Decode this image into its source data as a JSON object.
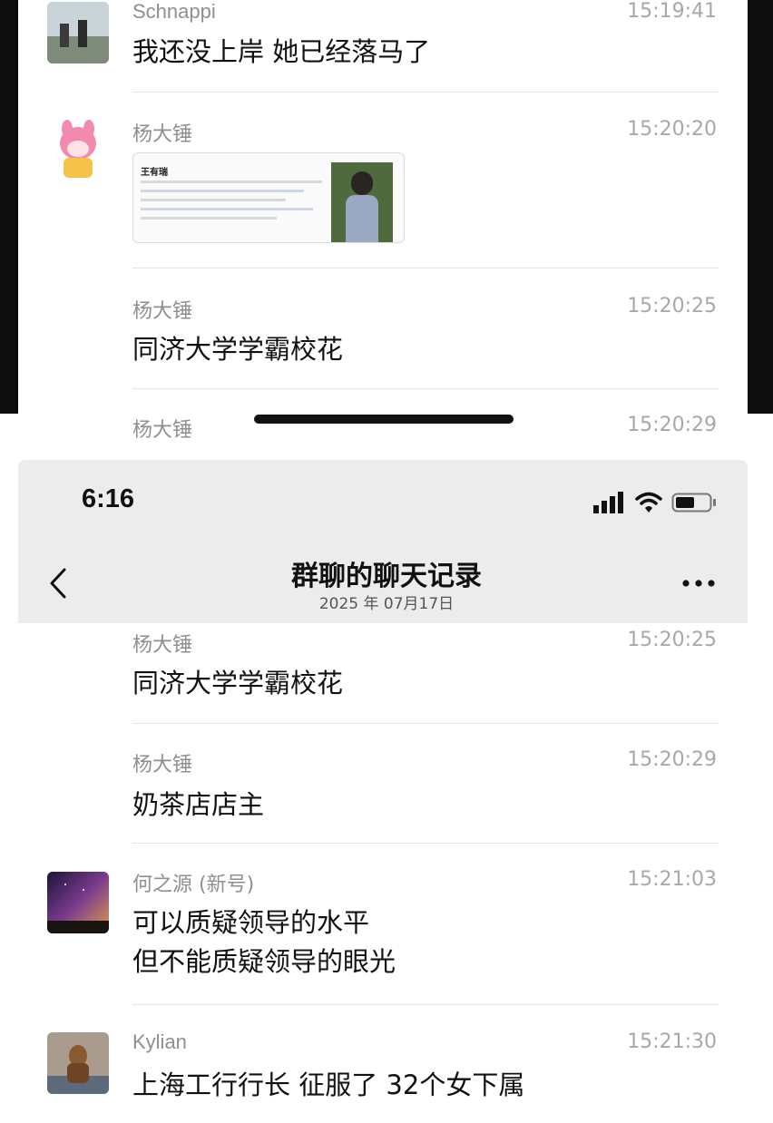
{
  "top_section": {
    "messages": [
      {
        "sender": "Schnappi",
        "time": "15:19:41",
        "text": "我还没上岸 她已经落马了"
      },
      {
        "sender": "杨大锤",
        "time": "15:20:20",
        "image_card": {
          "title": "王有瑞"
        }
      },
      {
        "sender": "杨大锤",
        "time": "15:20:25",
        "text": "同济大学学霸校花"
      },
      {
        "sender": "杨大锤",
        "time": "15:20:29"
      }
    ]
  },
  "status_bar": {
    "time": "6:16",
    "icons": [
      "signal-icon",
      "wifi-icon",
      "battery-icon"
    ]
  },
  "nav": {
    "title": "群聊的聊天记录",
    "subtitle": "2025 年 07月17日",
    "back_icon": "chevron-left-icon",
    "more_icon": "more-icon"
  },
  "bottom_section": {
    "messages": [
      {
        "sender": "杨大锤",
        "time": "15:20:25",
        "lines": [
          "同济大学学霸校花"
        ]
      },
      {
        "sender": "杨大锤",
        "time": "15:20:29",
        "lines": [
          "奶茶店店主"
        ]
      },
      {
        "sender": "何之源 (新号)",
        "time": "15:21:03",
        "lines": [
          "可以质疑领导的水平",
          "但不能质疑领导的眼光"
        ]
      },
      {
        "sender": "Kylian",
        "time": "15:21:30",
        "lines": [
          "上海工行行长 征服了 32个女下属"
        ]
      }
    ]
  }
}
